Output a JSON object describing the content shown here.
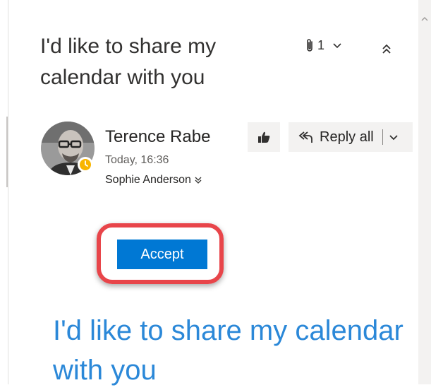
{
  "message": {
    "subject": "I'd like to share my calendar with you",
    "attachments": {
      "count": "1"
    }
  },
  "sender": {
    "name": "Terence Rabe",
    "time": "Today, 16:36",
    "recipient": "Sophie Anderson"
  },
  "actions": {
    "reply_all_label": "Reply all"
  },
  "invite": {
    "accept_label": "Accept"
  },
  "body": {
    "heading": "I'd like to share my calendar with you"
  },
  "colors": {
    "accent": "#0078d4",
    "link_blue": "#2b88d8",
    "highlight_red": "#e8454a",
    "presence_away": "#f8b500"
  },
  "icons": [
    "paperclip-icon",
    "chevron-down-icon",
    "collapse-up-icon",
    "like-icon",
    "reply-all-icon",
    "expand-recipients-icon",
    "presence-away-icon",
    "scroll-up-icon"
  ]
}
